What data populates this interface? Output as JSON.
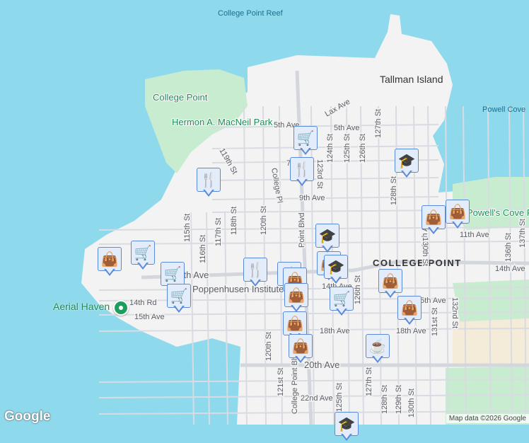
{
  "colors": {
    "water": "#8fd9ec",
    "land": "#f4f3f4",
    "park": "#c8ecd0",
    "marker": "#0d3f63"
  },
  "water_labels": {
    "reef": "College Point Reef",
    "cove": "Powell Cove"
  },
  "areas": {
    "college_point_park": "College Point",
    "macneil": "Hermon A. MacNeil Park",
    "tallman": "Tallman Island",
    "powells": "Powell's Cove Park",
    "neighborhood": "COLLEGE POINT"
  },
  "streets": [
    "5th Ave",
    "5th Ave",
    "Lax Ave",
    "7th Ave",
    "9th Ave",
    "119th St",
    "College Pl",
    "123rd St",
    "124th St",
    "125th St",
    "126th St",
    "127th St",
    "128th St",
    "11th Ave",
    "130th St",
    "11th Ave",
    "136th St",
    "137th St",
    "115th St",
    "116th St",
    "117th St",
    "118th St",
    "120th St",
    "Point Blvd",
    "14th Ave",
    "14th Ave",
    "14th Ave",
    "14th Rd",
    "15th Ave",
    "15th Ave",
    "15th Ave",
    "18th Ave",
    "18th Ave",
    "120th St",
    "126th St",
    "131st St",
    "132nd St",
    "20th Ave",
    "121st St",
    "College Point Blvd",
    "125th St",
    "127th St",
    "128th St",
    "129th St",
    "22nd Ave",
    "130th St",
    "Poppenhusen Institute"
  ],
  "poi": {
    "name": "Aerial Haven"
  },
  "markers": [
    "cart",
    "restaurant",
    "restaurant",
    "school",
    "shopping",
    "shopping",
    "shopping",
    "restaurant",
    "cart",
    "cart",
    "shopping",
    "school",
    "school",
    "cart",
    "restaurant",
    "shopping",
    "cart",
    "shopping",
    "shopping",
    "shopping",
    "coffee",
    "shopping",
    "school",
    "shopping"
  ],
  "logo": "Google",
  "attribution": "Map data ©2026 Google"
}
